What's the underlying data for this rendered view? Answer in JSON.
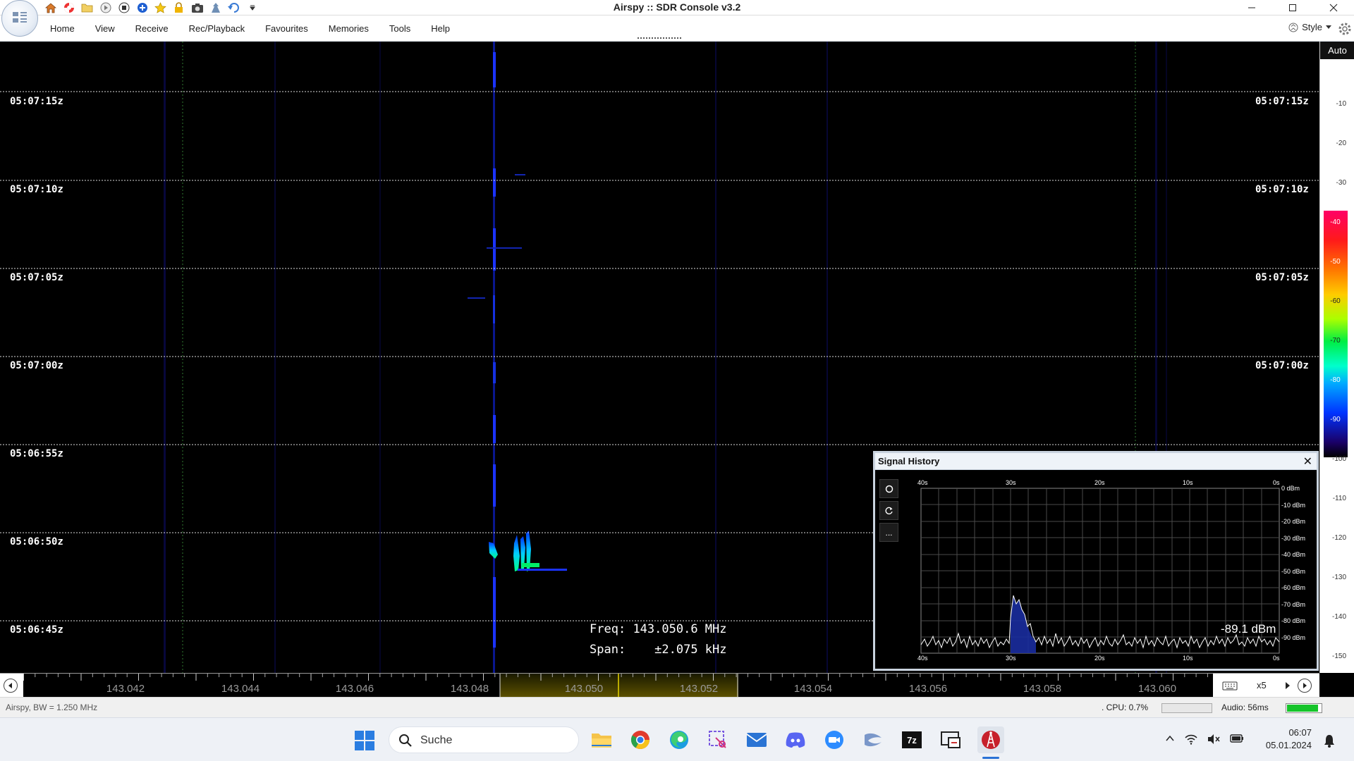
{
  "window": {
    "title": "Airspy :: SDR Console v3.2",
    "minimize_icon": "minimize-icon",
    "maximize_icon": "maximize-icon",
    "close_icon": "close-icon"
  },
  "quick_access": [
    "home-icon",
    "lifebuoy-icon",
    "folder-icon",
    "play-icon",
    "stop-icon",
    "plus-icon",
    "star-icon",
    "lock-icon",
    "camera-icon",
    "person-icon",
    "undo-icon",
    "dropdown-arrow-icon"
  ],
  "menu": {
    "items": [
      "Home",
      "View",
      "Receive",
      "Rec/Playback",
      "Favourites",
      "Memories",
      "Tools",
      "Help"
    ],
    "style_label": "Style"
  },
  "waterfall": {
    "time_labels": [
      "05:07:15z",
      "05:07:10z",
      "05:07:05z",
      "05:07:00z",
      "05:06:55z",
      "05:06:50z",
      "05:06:45z"
    ],
    "freq_label": "Freq:",
    "freq_value": "143.050.6 MHz",
    "span_label": "Span:",
    "span_value": "±2.075 kHz"
  },
  "scale": {
    "auto_label": "Auto",
    "ticks": [
      "-10",
      "-20",
      "-30",
      "-40",
      "-50",
      "-60",
      "-70",
      "-80",
      "-90",
      "-100",
      "-110",
      "-120",
      "-130",
      "-140",
      "-150"
    ]
  },
  "freq_axis": {
    "labels": [
      "143.042",
      "143.044",
      "143.046",
      "143.048",
      "143.050",
      "143.052",
      "143.054",
      "143.056",
      "143.058",
      "143.060"
    ],
    "zoom_value": "x5"
  },
  "signal_history": {
    "title": "Signal History",
    "current_value": "-89.1 dBm",
    "time_labels": [
      "40s",
      "30s",
      "20s",
      "10s",
      "0s"
    ],
    "db_labels": [
      "0 dBm",
      "-10 dBm",
      "-20 dBm",
      "-30 dBm",
      "-40 dBm",
      "-50 dBm",
      "-60 dBm",
      "-70 dBm",
      "-80 dBm",
      "-90 dBm"
    ],
    "tool_more": "..."
  },
  "status": {
    "left": "Airspy, BW = 1.250 MHz",
    "cpu": ". CPU: 0.7%",
    "audio": "Audio: 56ms",
    "audio_level": 0.88
  },
  "taskbar": {
    "search_placeholder": "Suche",
    "apps": [
      "file-explorer-icon",
      "chrome-icon",
      "edge-icon",
      "snipping-tool-icon",
      "mail-icon",
      "discord-icon",
      "zoom-icon",
      "vs-icon",
      "7zip-icon",
      "remote-desktop-icon",
      "sdr-console-icon"
    ],
    "time": "06:07",
    "date": "05.01.2024"
  }
}
